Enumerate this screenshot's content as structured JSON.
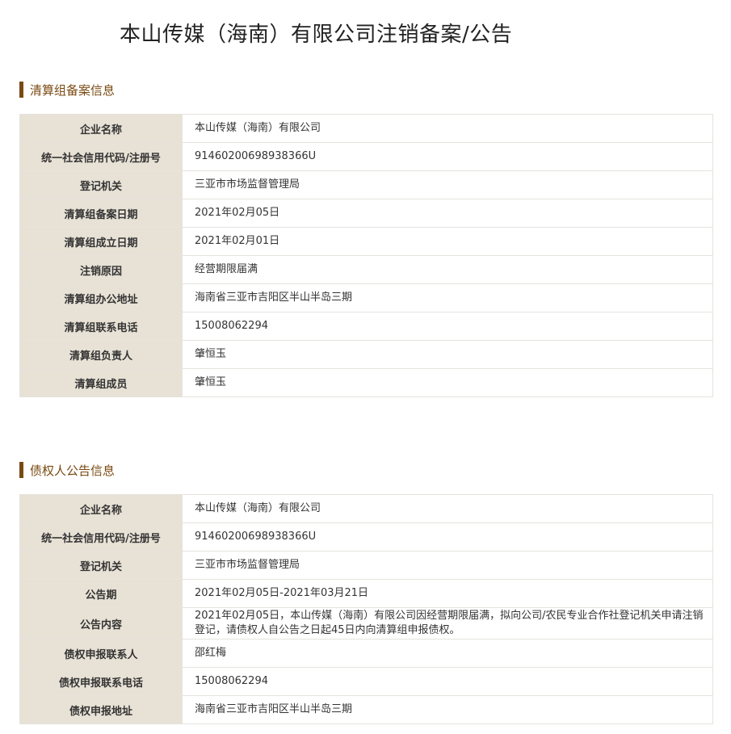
{
  "page_title": "本山传媒（海南）有限公司注销备案/公告",
  "colors": {
    "accent": "#7a4a12",
    "label_bg": "#e8e2d6",
    "border": "#e6e3dd"
  },
  "sections": [
    {
      "title": "清算组备案信息",
      "rows": [
        {
          "label": "企业名称",
          "value": "本山传媒（海南）有限公司"
        },
        {
          "label": "统一社会信用代码/注册号",
          "value": "91460200698938366U"
        },
        {
          "label": "登记机关",
          "value": "三亚市市场监督管理局"
        },
        {
          "label": "清算组备案日期",
          "value": "2021年02月05日"
        },
        {
          "label": "清算组成立日期",
          "value": "2021年02月01日"
        },
        {
          "label": "注销原因",
          "value": "经营期限届满"
        },
        {
          "label": "清算组办公地址",
          "value": "海南省三亚市吉阳区半山半岛三期"
        },
        {
          "label": "清算组联系电话",
          "value": "15008062294"
        },
        {
          "label": "清算组负责人",
          "value": "肇恒玉"
        },
        {
          "label": "清算组成员",
          "value": "肇恒玉"
        }
      ]
    },
    {
      "title": "债权人公告信息",
      "rows": [
        {
          "label": "企业名称",
          "value": "本山传媒（海南）有限公司"
        },
        {
          "label": "统一社会信用代码/注册号",
          "value": "91460200698938366U"
        },
        {
          "label": "登记机关",
          "value": "三亚市市场监督管理局"
        },
        {
          "label": "公告期",
          "value": "2021年02月05日-2021年03月21日"
        },
        {
          "label": "公告内容",
          "value": "2021年02月05日，本山传媒（海南）有限公司因经营期限届满，拟向公司/农民专业合作社登记机关申请注销登记，请债权人自公告之日起45日内向清算组申报债权。"
        },
        {
          "label": "债权申报联系人",
          "value": "邵红梅"
        },
        {
          "label": "债权申报联系电话",
          "value": "15008062294"
        },
        {
          "label": "债权申报地址",
          "value": "海南省三亚市吉阳区半山半岛三期"
        }
      ]
    }
  ]
}
